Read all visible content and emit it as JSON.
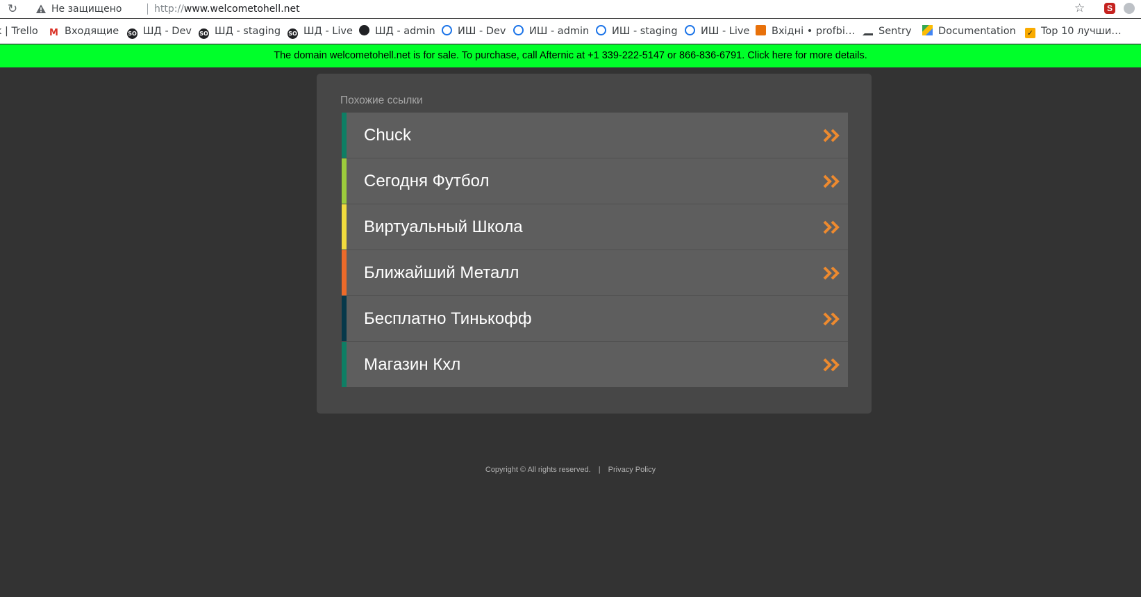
{
  "browser": {
    "security_label": "Не защищено",
    "url_scheme": "http://",
    "url_host": "www.welcometohell.net"
  },
  "bookmarks": [
    {
      "label": "k | Trello",
      "icon": "none"
    },
    {
      "label": "Входящие",
      "icon": "gmail-icon"
    },
    {
      "label": "ШД - Dev",
      "icon": "so-icon"
    },
    {
      "label": "ШД - staging",
      "icon": "so-icon"
    },
    {
      "label": "ШД - Live",
      "icon": "so-icon"
    },
    {
      "label": "ШД - admin",
      "icon": "globe-icon"
    },
    {
      "label": "ИШ - Dev",
      "icon": "swirl-icon"
    },
    {
      "label": "ИШ - admin",
      "icon": "swirl-icon"
    },
    {
      "label": "ИШ - staging",
      "icon": "swirl-icon"
    },
    {
      "label": "ИШ - Live",
      "icon": "swirl-icon"
    },
    {
      "label": "Вхідні • profbi…",
      "icon": "gift-icon"
    },
    {
      "label": "Sentry",
      "icon": "sentry-icon"
    },
    {
      "label": "Documentation",
      "icon": "drive-icon"
    },
    {
      "label": "Top 10 лучши…",
      "icon": "checkbox-icon"
    }
  ],
  "banner": {
    "text": "The domain welcometohell.net is for sale. To purchase, call Afternic at +1 339-222-5147 or 866-836-6791. Click here for more details.",
    "color": "#00ff2a"
  },
  "panel": {
    "title": "Похожие ссылки",
    "links": [
      {
        "label": "Chuck",
        "accent": "#0e7e64"
      },
      {
        "label": "Сегодня Футбол",
        "accent": "#9ccc3c"
      },
      {
        "label": "Виртуальный Школа",
        "accent": "#f2dc3e"
      },
      {
        "label": "Ближайший Металл",
        "accent": "#ec6a2a"
      },
      {
        "label": "Бесплатно Тинькофф",
        "accent": "#06384a"
      },
      {
        "label": "Магазин Кхл",
        "accent": "#0e7e64"
      }
    ],
    "arrow_color": "#ed8a2f"
  },
  "footer": {
    "copyright": "Copyright ©  All rights reserved.",
    "separator": "|",
    "privacy": "Privacy Policy"
  }
}
